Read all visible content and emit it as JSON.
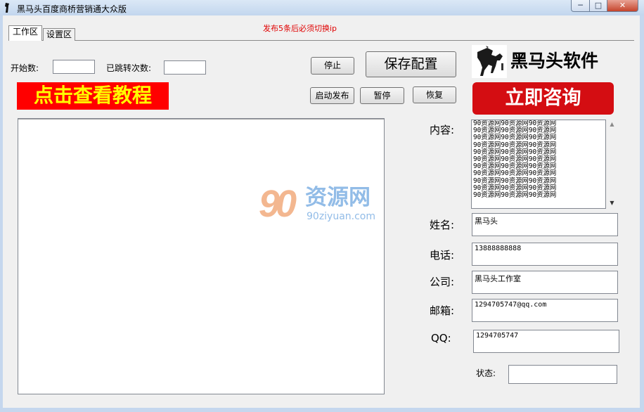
{
  "window": {
    "title": "黑马头百度商桥营销通大众版",
    "minimize": "─",
    "maximize": "□",
    "close": "✕"
  },
  "tabs": {
    "work": "工作区",
    "settings": "设置区"
  },
  "notice": "发布5条后必须切换ip",
  "fields": {
    "start_count_label": "开始数:",
    "start_count_value": "",
    "jumped_count_label": "已跳转次数:",
    "jumped_count_value": ""
  },
  "buttons": {
    "stop": "停止",
    "save_config": "保存配置",
    "start_publish": "启动发布",
    "pause": "暂停",
    "resume": "恢复"
  },
  "tutorial_banner": "点击查看教程",
  "brand": {
    "name": "黑马头软件",
    "consult": "立即咨询"
  },
  "watermark": {
    "digits": "90",
    "name": "资源网",
    "url": "90ziyuan.com"
  },
  "form": {
    "content_label": "内容:",
    "content_lines": [
      "90资源网90资源网90资源网",
      "90资源网90资源网90资源网",
      "90资源网90资源网90资源网",
      "90资源网90资源网90资源网",
      "90资源网90资源网90资源网",
      "90资源网90资源网90资源网",
      "90资源网90资源网90资源网",
      "90资源网90资源网90资源网",
      "90资源网90资源网90资源网",
      "90资源网90资源网90资源网",
      "90资源网90资源网90资源网"
    ],
    "name_label": "姓名:",
    "name_value": "黑马头",
    "phone_label": "电话:",
    "phone_value": "13888888888",
    "company_label": "公司:",
    "company_value": "黑马头工作室",
    "email_label": "邮箱:",
    "email_value": "1294705747@qq.com",
    "qq_label": "QQ:",
    "qq_value": "1294705747",
    "status_label": "状态:",
    "status_value": ""
  },
  "colors": {
    "notice": "#e00000",
    "banner_bg": "#ff0000",
    "banner_text": "#ffff00",
    "consult_bg": "#d40d12"
  }
}
